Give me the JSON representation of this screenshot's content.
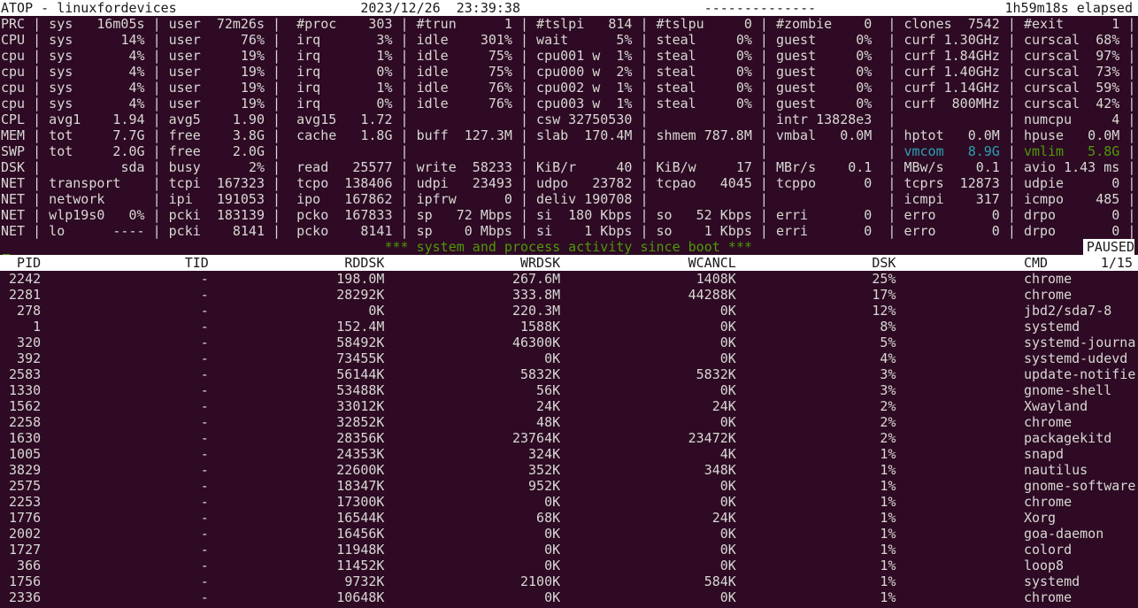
{
  "header": {
    "title": "ATOP - linuxfordevices",
    "datetime": "2023/12/26  23:39:38",
    "dashes": "--------------",
    "elapsed": "1h59m18s elapsed"
  },
  "colors": {
    "background": "#2e0a24",
    "text": "#d8d8d4",
    "cyan": "#2aa1b3",
    "green": "#4e9a06"
  },
  "system": {
    "rows": [
      {
        "label": "PRC",
        "fields": [
          [
            "sys",
            "16m05s"
          ],
          [
            "user",
            "72m26s"
          ],
          [
            "#proc",
            "303"
          ],
          [
            "#trun",
            "1"
          ],
          [
            "#tslpi",
            "814"
          ],
          [
            "#tslpu",
            "0"
          ],
          [
            "#zombie",
            "0"
          ],
          [
            "clones",
            "7542"
          ],
          [
            "#exit",
            "1"
          ]
        ]
      },
      {
        "label": "CPU",
        "fields": [
          [
            "sys",
            "14%"
          ],
          [
            "user",
            "76%"
          ],
          [
            "irq",
            "3%"
          ],
          [
            "idle",
            "301%"
          ],
          [
            "wait",
            "5%"
          ],
          [
            "steal",
            "0%"
          ],
          [
            "guest",
            "0%"
          ],
          [
            "curf",
            "1.30GHz"
          ],
          [
            "curscal",
            "68%"
          ]
        ]
      },
      {
        "label": "cpu",
        "fields": [
          [
            "sys",
            "4%"
          ],
          [
            "user",
            "19%"
          ],
          [
            "irq",
            "1%"
          ],
          [
            "idle",
            "75%"
          ],
          [
            "cpu001 w",
            "1%"
          ],
          [
            "steal",
            "0%"
          ],
          [
            "guest",
            "0%"
          ],
          [
            "curf",
            "1.84GHz"
          ],
          [
            "curscal",
            "97%"
          ]
        ]
      },
      {
        "label": "cpu",
        "fields": [
          [
            "sys",
            "4%"
          ],
          [
            "user",
            "19%"
          ],
          [
            "irq",
            "0%"
          ],
          [
            "idle",
            "75%"
          ],
          [
            "cpu000 w",
            "2%"
          ],
          [
            "steal",
            "0%"
          ],
          [
            "guest",
            "0%"
          ],
          [
            "curf",
            "1.40GHz"
          ],
          [
            "curscal",
            "73%"
          ]
        ]
      },
      {
        "label": "cpu",
        "fields": [
          [
            "sys",
            "4%"
          ],
          [
            "user",
            "19%"
          ],
          [
            "irq",
            "1%"
          ],
          [
            "idle",
            "76%"
          ],
          [
            "cpu002 w",
            "1%"
          ],
          [
            "steal",
            "0%"
          ],
          [
            "guest",
            "0%"
          ],
          [
            "curf",
            "1.14GHz"
          ],
          [
            "curscal",
            "59%"
          ]
        ]
      },
      {
        "label": "cpu",
        "fields": [
          [
            "sys",
            "4%"
          ],
          [
            "user",
            "19%"
          ],
          [
            "irq",
            "0%"
          ],
          [
            "idle",
            "76%"
          ],
          [
            "cpu003 w",
            "1%"
          ],
          [
            "steal",
            "0%"
          ],
          [
            "guest",
            "0%"
          ],
          [
            "curf",
            "800MHz"
          ],
          [
            "curscal",
            "42%"
          ]
        ]
      },
      {
        "label": "CPL",
        "fields": [
          [
            "avg1",
            "1.94"
          ],
          [
            "avg5",
            "1.90"
          ],
          [
            "avg15",
            "1.72"
          ],
          [
            "",
            ""
          ],
          [
            "csw",
            "32750530"
          ],
          [
            "",
            ""
          ],
          [
            "intr",
            "13828e3"
          ],
          [
            "",
            ""
          ],
          [
            "numcpu",
            "4"
          ]
        ]
      },
      {
        "label": "MEM",
        "fields": [
          [
            "tot",
            "7.7G"
          ],
          [
            "free",
            "3.8G"
          ],
          [
            "cache",
            "1.8G"
          ],
          [
            "buff",
            "127.3M"
          ],
          [
            "slab",
            "170.4M"
          ],
          [
            "shmem",
            "787.8M"
          ],
          [
            "vmbal",
            "0.0M"
          ],
          [
            "hptot",
            "0.0M"
          ],
          [
            "hpuse",
            "0.0M"
          ]
        ]
      },
      {
        "label": "SWP",
        "fields": [
          [
            "tot",
            "2.0G"
          ],
          [
            "free",
            "2.0G"
          ],
          [
            "",
            ""
          ],
          [
            "",
            ""
          ],
          [
            "",
            ""
          ],
          [
            "",
            ""
          ],
          [
            "",
            ""
          ],
          [
            "vmcom",
            "8.9G",
            "cyan"
          ],
          [
            "vmlim",
            "5.8G",
            "green"
          ]
        ]
      },
      {
        "label": "DSK",
        "fields": [
          [
            "",
            "sda"
          ],
          [
            "busy",
            "2%"
          ],
          [
            "read",
            "25577"
          ],
          [
            "write",
            "58233"
          ],
          [
            "KiB/r",
            "40"
          ],
          [
            "KiB/w",
            "17"
          ],
          [
            "MBr/s",
            "0.1"
          ],
          [
            "MBw/s",
            "0.1"
          ],
          [
            "avio",
            "1.43 ms"
          ]
        ]
      },
      {
        "label": "NET",
        "fields": [
          [
            "transport",
            ""
          ],
          [
            "tcpi",
            "167323"
          ],
          [
            "tcpo",
            "138406"
          ],
          [
            "udpi",
            "23493"
          ],
          [
            "udpo",
            "23782"
          ],
          [
            "tcpao",
            "4045"
          ],
          [
            "tcppo",
            "0"
          ],
          [
            "tcprs",
            "12873"
          ],
          [
            "udpie",
            "0"
          ]
        ]
      },
      {
        "label": "NET",
        "fields": [
          [
            "network",
            ""
          ],
          [
            "ipi",
            "191053"
          ],
          [
            "ipo",
            "167862"
          ],
          [
            "ipfrw",
            "0"
          ],
          [
            "deliv",
            "190708"
          ],
          [
            "",
            ""
          ],
          [
            "",
            ""
          ],
          [
            "icmpi",
            "317"
          ],
          [
            "icmpo",
            "485"
          ]
        ]
      },
      {
        "label": "NET",
        "fields": [
          [
            "wlp19s0",
            "0%"
          ],
          [
            "pcki",
            "183139"
          ],
          [
            "pcko",
            "167833"
          ],
          [
            "sp",
            "72 Mbps"
          ],
          [
            "si",
            "180 Kbps"
          ],
          [
            "so",
            "52 Kbps"
          ],
          [
            "erri",
            "0"
          ],
          [
            "erro",
            "0"
          ],
          [
            "drpo",
            "0"
          ]
        ]
      },
      {
        "label": "NET",
        "fields": [
          [
            "lo",
            "----"
          ],
          [
            "pcki",
            "8141"
          ],
          [
            "pcko",
            "8141"
          ],
          [
            "sp",
            "0 Mbps"
          ],
          [
            "si",
            "1 Kbps"
          ],
          [
            "so",
            "1 Kbps"
          ],
          [
            "erri",
            "0"
          ],
          [
            "erro",
            "0"
          ],
          [
            "drpo",
            "0"
          ]
        ]
      }
    ],
    "separator": "|"
  },
  "banner": "*** system and process activity since boot ***",
  "status": "PAUSED",
  "process": {
    "columns": [
      "PID",
      "TID",
      "RDDSK",
      "WRDSK",
      "WCANCL",
      "DSK",
      "CMD"
    ],
    "page": "1/15",
    "rows": [
      [
        "2242",
        "-",
        "198.0M",
        "267.6M",
        "1408K",
        "25%",
        "chrome"
      ],
      [
        "2281",
        "-",
        "28292K",
        "333.8M",
        "44288K",
        "17%",
        "chrome"
      ],
      [
        "278",
        "-",
        "0K",
        "220.3M",
        "0K",
        "12%",
        "jbd2/sda7-8"
      ],
      [
        "1",
        "-",
        "152.4M",
        "1588K",
        "0K",
        "8%",
        "systemd"
      ],
      [
        "320",
        "-",
        "58492K",
        "46300K",
        "0K",
        "5%",
        "systemd-journa"
      ],
      [
        "392",
        "-",
        "73455K",
        "0K",
        "0K",
        "4%",
        "systemd-udevd"
      ],
      [
        "2583",
        "-",
        "56144K",
        "5832K",
        "5832K",
        "3%",
        "update-notifie"
      ],
      [
        "1330",
        "-",
        "53488K",
        "56K",
        "0K",
        "3%",
        "gnome-shell"
      ],
      [
        "1562",
        "-",
        "33012K",
        "24K",
        "24K",
        "2%",
        "Xwayland"
      ],
      [
        "2258",
        "-",
        "32852K",
        "48K",
        "0K",
        "2%",
        "chrome"
      ],
      [
        "1630",
        "-",
        "28356K",
        "23764K",
        "23472K",
        "2%",
        "packagekitd"
      ],
      [
        "1005",
        "-",
        "24353K",
        "324K",
        "4K",
        "1%",
        "snapd"
      ],
      [
        "3829",
        "-",
        "22600K",
        "352K",
        "348K",
        "1%",
        "nautilus"
      ],
      [
        "2575",
        "-",
        "18347K",
        "952K",
        "0K",
        "1%",
        "gnome-software"
      ],
      [
        "2253",
        "-",
        "17300K",
        "0K",
        "0K",
        "1%",
        "chrome"
      ],
      [
        "1776",
        "-",
        "16544K",
        "68K",
        "24K",
        "1%",
        "Xorg"
      ],
      [
        "2002",
        "-",
        "16456K",
        "0K",
        "0K",
        "1%",
        "goa-daemon"
      ],
      [
        "1727",
        "-",
        "11948K",
        "0K",
        "0K",
        "1%",
        "colord"
      ],
      [
        "366",
        "-",
        "11452K",
        "0K",
        "0K",
        "1%",
        "loop8"
      ],
      [
        "1756",
        "-",
        "9732K",
        "2100K",
        "584K",
        "1%",
        "systemd"
      ],
      [
        "2336",
        "-",
        "10648K",
        "0K",
        "0K",
        "1%",
        "chrome"
      ]
    ]
  }
}
